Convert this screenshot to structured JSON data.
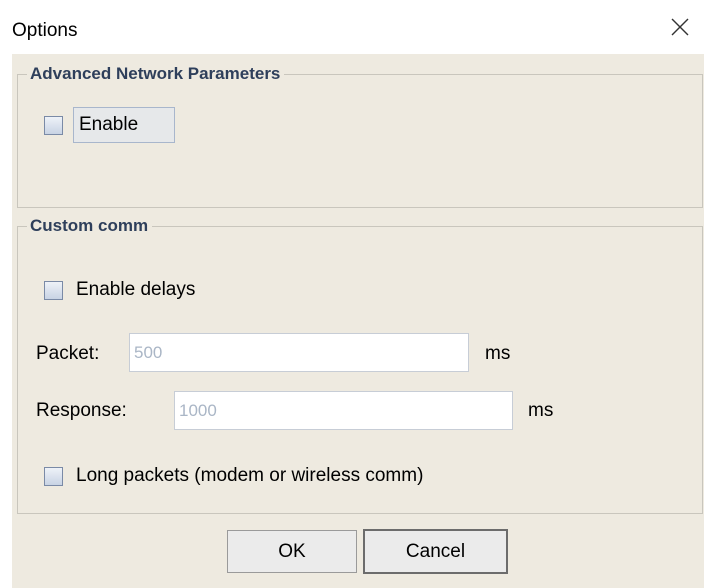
{
  "window": {
    "title": "Options",
    "close_icon": "close-icon"
  },
  "advanced": {
    "group_title": "Advanced Network Parameters",
    "enable_label": "Enable",
    "enable_checked": false
  },
  "custom": {
    "group_title": "Custom comm",
    "enable_delays_label": "Enable delays",
    "enable_delays_checked": false,
    "packet_label": "Packet:",
    "packet_placeholder": "500",
    "packet_unit": "ms",
    "response_label": "Response:",
    "response_placeholder": "1000",
    "response_unit": "ms",
    "long_packets_label": "Long packets (modem or wireless comm)",
    "long_packets_checked": false
  },
  "buttons": {
    "ok_label": "OK",
    "cancel_label": "Cancel"
  },
  "colors": {
    "dialog_bg": "#eeeae0",
    "group_title": "#2e3f5b",
    "placeholder": "#aab6c6"
  }
}
